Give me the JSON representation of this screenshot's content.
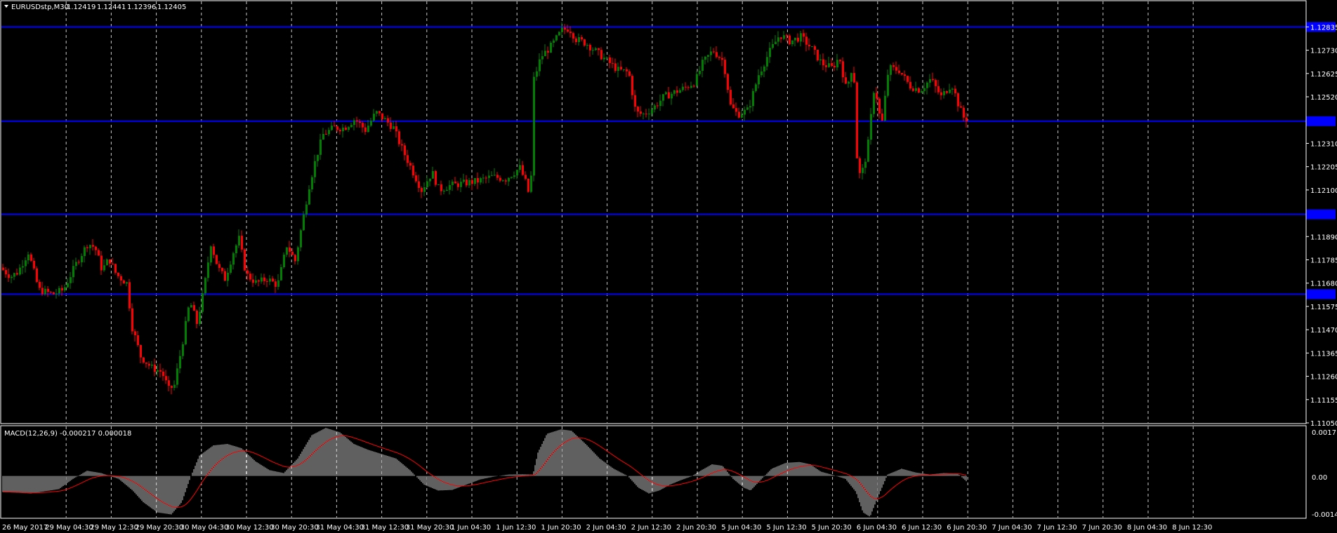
{
  "symbol_label": "EURUSDstp,M30",
  "ohlc": {
    "open": "1.12419",
    "high": "1.12441",
    "low": "1.12396",
    "close": "1.12405"
  },
  "price_ticks": [
    "1.12835",
    "1.12730",
    "1.12625",
    "1.12520",
    "1.12310",
    "1.12205",
    "1.12100",
    "1.11890",
    "1.11785",
    "1.11680",
    "1.11575",
    "1.11470",
    "1.11365",
    "1.11260",
    "1.11155",
    "1.11050"
  ],
  "time_ticks": [
    "26 May 2017",
    "29 May 04:30",
    "29 May 12:30",
    "29 May 20:30",
    "30 May 04:30",
    "30 May 12:30",
    "30 May 20:30",
    "31 May 04:30",
    "31 May 12:30",
    "31 May 20:30",
    "1 Jun 04:30",
    "1 Jun 12:30",
    "1 Jun 20:30",
    "2 Jun 04:30",
    "2 Jun 12:30",
    "2 Jun 20:30",
    "5 Jun 04:30",
    "5 Jun 12:30",
    "5 Jun 20:30",
    "6 Jun 04:30",
    "6 Jun 12:30",
    "6 Jun 20:30",
    "7 Jun 04:30",
    "7 Jun 12:30",
    "7 Jun 20:30",
    "8 Jun 04:30",
    "8 Jun 12:30"
  ],
  "macd": {
    "label": "MACD(12,26,9) -0.000217 0.000018",
    "scale_top": "0.0017",
    "scale_zero": "0.00",
    "scale_bottom": "-0.001427"
  },
  "colors": {
    "background": "#000000",
    "bull": "#008000",
    "bear": "#ff0000",
    "hline": "#0000ff",
    "grid": "#c8c8c8",
    "macd_hist": "#c0c0c0",
    "signal": "#ff0000"
  },
  "chart_data": {
    "type": "line",
    "title": "EURUSDstp,M30",
    "price_range": [
      1.1105,
      1.1295
    ],
    "horizontal_levels": [
      1.12835,
      1.1241,
      1.1199,
      1.1163
    ],
    "price_path": [
      [
        0,
        1.1175
      ],
      [
        15,
        1.1171
      ],
      [
        25,
        1.1173
      ],
      [
        40,
        1.1182
      ],
      [
        55,
        1.1165
      ],
      [
        75,
        1.1163
      ],
      [
        90,
        1.1165
      ],
      [
        110,
        1.1178
      ],
      [
        125,
        1.1186
      ],
      [
        135,
        1.1184
      ],
      [
        145,
        1.1174
      ],
      [
        155,
        1.1179
      ],
      [
        165,
        1.1172
      ],
      [
        180,
        1.1168
      ],
      [
        188,
        1.1148
      ],
      [
        200,
        1.1135
      ],
      [
        215,
        1.113
      ],
      [
        230,
        1.1128
      ],
      [
        240,
        1.112
      ],
      [
        248,
        1.1122
      ],
      [
        260,
        1.1142
      ],
      [
        270,
        1.116
      ],
      [
        280,
        1.115
      ],
      [
        290,
        1.1165
      ],
      [
        300,
        1.1186
      ],
      [
        310,
        1.1175
      ],
      [
        320,
        1.117
      ],
      [
        332,
        1.1182
      ],
      [
        340,
        1.1188
      ],
      [
        350,
        1.1172
      ],
      [
        365,
        1.1168
      ],
      [
        380,
        1.117
      ],
      [
        395,
        1.1167
      ],
      [
        408,
        1.1185
      ],
      [
        420,
        1.1178
      ],
      [
        430,
        1.1195
      ],
      [
        440,
        1.1212
      ],
      [
        450,
        1.1225
      ],
      [
        460,
        1.1235
      ],
      [
        475,
        1.1238
      ],
      [
        490,
        1.1238
      ],
      [
        505,
        1.1242
      ],
      [
        520,
        1.1237
      ],
      [
        535,
        1.1245
      ],
      [
        550,
        1.1241
      ],
      [
        560,
        1.1238
      ],
      [
        570,
        1.123
      ],
      [
        585,
        1.122
      ],
      [
        600,
        1.121
      ],
      [
        615,
        1.1218
      ],
      [
        625,
        1.121
      ],
      [
        640,
        1.1212
      ],
      [
        660,
        1.1213
      ],
      [
        680,
        1.1214
      ],
      [
        700,
        1.1216
      ],
      [
        720,
        1.1215
      ],
      [
        740,
        1.122
      ],
      [
        750,
        1.1212
      ],
      [
        755,
        1.1205
      ],
      [
        760,
        1.126
      ],
      [
        770,
        1.127
      ],
      [
        785,
        1.1275
      ],
      [
        800,
        1.1282
      ],
      [
        810,
        1.1283
      ],
      [
        820,
        1.1278
      ],
      [
        835,
        1.1276
      ],
      [
        850,
        1.1272
      ],
      [
        865,
        1.1268
      ],
      [
        880,
        1.1264
      ],
      [
        895,
        1.1263
      ],
      [
        905,
        1.1245
      ],
      [
        915,
        1.1244
      ],
      [
        930,
        1.1247
      ],
      [
        945,
        1.1252
      ],
      [
        960,
        1.1254
      ],
      [
        975,
        1.1256
      ],
      [
        990,
        1.1259
      ],
      [
        1000,
        1.1267
      ],
      [
        1015,
        1.1273
      ],
      [
        1030,
        1.1268
      ],
      [
        1040,
        1.1248
      ],
      [
        1050,
        1.1244
      ],
      [
        1065,
        1.1246
      ],
      [
        1080,
        1.1262
      ],
      [
        1095,
        1.1272
      ],
      [
        1110,
        1.128
      ],
      [
        1125,
        1.1277
      ],
      [
        1140,
        1.1279
      ],
      [
        1155,
        1.1274
      ],
      [
        1170,
        1.1267
      ],
      [
        1185,
        1.1265
      ],
      [
        1195,
        1.127
      ],
      [
        1205,
        1.1255
      ],
      [
        1215,
        1.1268
      ],
      [
        1220,
        1.1225
      ],
      [
        1225,
        1.1215
      ],
      [
        1235,
        1.1228
      ],
      [
        1245,
        1.1258
      ],
      [
        1255,
        1.1238
      ],
      [
        1265,
        1.1265
      ],
      [
        1280,
        1.1264
      ],
      [
        1295,
        1.1257
      ],
      [
        1310,
        1.1255
      ],
      [
        1325,
        1.126
      ],
      [
        1340,
        1.1252
      ],
      [
        1355,
        1.1258
      ],
      [
        1366,
        1.1247
      ],
      [
        1373,
        1.1242
      ]
    ],
    "macd_histogram_path": [
      [
        0,
        -0.00055
      ],
      [
        40,
        -0.0006
      ],
      [
        80,
        -0.00045
      ],
      [
        100,
        -0.0001
      ],
      [
        120,
        0.00018
      ],
      [
        140,
        0.0001
      ],
      [
        165,
        -0.0001
      ],
      [
        185,
        -0.0005
      ],
      [
        200,
        -0.0009
      ],
      [
        220,
        -0.00125
      ],
      [
        240,
        -0.00132
      ],
      [
        255,
        -0.0009
      ],
      [
        268,
        0.0
      ],
      [
        280,
        0.0007
      ],
      [
        300,
        0.00105
      ],
      [
        320,
        0.0011
      ],
      [
        340,
        0.00095
      ],
      [
        360,
        0.0005
      ],
      [
        380,
        0.0002
      ],
      [
        400,
        0.0001
      ],
      [
        420,
        0.0006
      ],
      [
        440,
        0.0014
      ],
      [
        460,
        0.00165
      ],
      [
        480,
        0.0015
      ],
      [
        500,
        0.0011
      ],
      [
        520,
        0.0009
      ],
      [
        540,
        0.00075
      ],
      [
        560,
        0.0006
      ],
      [
        580,
        0.0002
      ],
      [
        600,
        -0.0003
      ],
      [
        620,
        -0.0005
      ],
      [
        640,
        -0.00048
      ],
      [
        660,
        -0.0003
      ],
      [
        680,
        -0.00012
      ],
      [
        700,
        -2e-05
      ],
      [
        720,
        5e-05
      ],
      [
        740,
        6e-05
      ],
      [
        755,
        5e-05
      ],
      [
        762,
        0.0008
      ],
      [
        775,
        0.00145
      ],
      [
        795,
        0.0016
      ],
      [
        810,
        0.00155
      ],
      [
        830,
        0.0011
      ],
      [
        850,
        0.0006
      ],
      [
        870,
        0.00025
      ],
      [
        890,
        0.0
      ],
      [
        905,
        -0.0004
      ],
      [
        920,
        -0.0006
      ],
      [
        935,
        -0.0005
      ],
      [
        950,
        -0.0003
      ],
      [
        965,
        -0.00015
      ],
      [
        980,
        -2e-05
      ],
      [
        995,
        0.0002
      ],
      [
        1010,
        0.0004
      ],
      [
        1025,
        0.00035
      ],
      [
        1040,
        -0.0001
      ],
      [
        1055,
        -0.0004
      ],
      [
        1065,
        -0.0005
      ],
      [
        1080,
        -0.00012
      ],
      [
        1095,
        0.00025
      ],
      [
        1115,
        0.00045
      ],
      [
        1135,
        0.00048
      ],
      [
        1150,
        0.0004
      ],
      [
        1165,
        0.00015
      ],
      [
        1180,
        5e-05
      ],
      [
        1200,
        -0.0001
      ],
      [
        1215,
        -0.00055
      ],
      [
        1225,
        -0.00125
      ],
      [
        1235,
        -0.0014
      ],
      [
        1245,
        -0.0008
      ],
      [
        1260,
        5e-05
      ],
      [
        1280,
        0.00025
      ],
      [
        1300,
        0.00012
      ],
      [
        1320,
        5e-05
      ],
      [
        1340,
        0.0001
      ],
      [
        1360,
        8e-05
      ],
      [
        1373,
        -0.0002
      ]
    ]
  }
}
